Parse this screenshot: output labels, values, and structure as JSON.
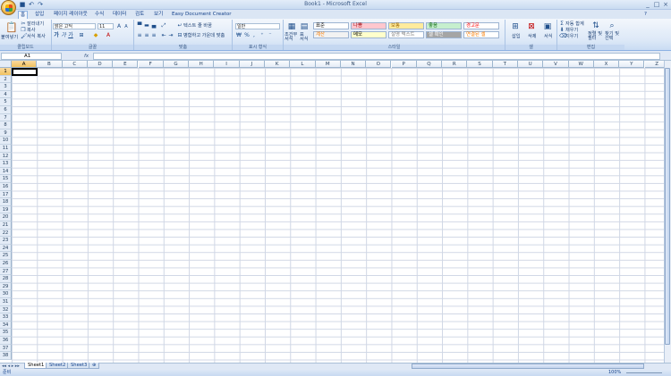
{
  "window": {
    "title": "Book1 - Microsoft Excel",
    "controls": [
      "_",
      "□",
      "×"
    ]
  },
  "qat": {
    "save_icon": "save-icon",
    "undo_icon": "undo-icon",
    "redo_icon": "redo-icon"
  },
  "tabs": [
    {
      "label": "홈",
      "active": true
    },
    {
      "label": "삽입"
    },
    {
      "label": "페이지 레이아웃"
    },
    {
      "label": "수식"
    },
    {
      "label": "데이터"
    },
    {
      "label": "검토"
    },
    {
      "label": "보기"
    },
    {
      "label": "Easy Document Creator"
    }
  ],
  "ribbon": {
    "clipboard": {
      "paste_label": "붙여넣기",
      "cut_label": "잘라내기",
      "copy_label": "복사",
      "format_painter_label": "서식 복사",
      "group_label": "클립보드"
    },
    "font": {
      "font_name": "맑은 고딕",
      "font_size": "11",
      "group_label": "글꼴"
    },
    "alignment": {
      "wrap_text_label": "텍스트 줄 바꿈",
      "merge_center_label": "병합하고 가운데 맞춤",
      "group_label": "맞춤"
    },
    "number": {
      "format": "일반",
      "group_label": "표시 형식"
    },
    "styles": {
      "conditional_label": "조건부\n서식",
      "table_label": "표\n서식",
      "group_label": "스타일",
      "cells": [
        {
          "label": "표준",
          "bg": "#ffffff",
          "color": "#000000"
        },
        {
          "label": "나쁨",
          "bg": "#ffc7ce",
          "color": "#9c0006"
        },
        {
          "label": "보통",
          "bg": "#ffeb9c",
          "color": "#9c6500"
        },
        {
          "label": "좋음",
          "bg": "#c6efce",
          "color": "#006100"
        },
        {
          "label": "경고문",
          "bg": "#ffffff",
          "color": "#ff0000"
        },
        {
          "label": "계산",
          "bg": "#f2f2f2",
          "color": "#fa7d00"
        },
        {
          "label": "메모",
          "bg": "#ffffcc",
          "color": "#000000"
        },
        {
          "label": "설명 텍스트",
          "bg": "#ffffff",
          "color": "#7f7f7f"
        },
        {
          "label": "셀 확인",
          "bg": "#a5a5a5",
          "color": "#ffffff"
        },
        {
          "label": "연결된 셀",
          "bg": "#ffffff",
          "color": "#fa7d00"
        }
      ]
    },
    "cells_group": {
      "insert_label": "삽입",
      "delete_label": "삭제",
      "format_label": "서식",
      "group_label": "셀"
    },
    "editing": {
      "autosum_label": "자동 합계",
      "fill_label": "채우기",
      "clear_label": "지우기",
      "sort_label": "정렬 및\n필터",
      "find_label": "찾기 및\n선택",
      "group_label": "편집"
    }
  },
  "formula_bar": {
    "name_box": "A1",
    "fx": "fx",
    "value": ""
  },
  "columns": [
    "A",
    "B",
    "C",
    "D",
    "E",
    "F",
    "G",
    "H",
    "I",
    "J",
    "K",
    "L",
    "M",
    "N",
    "O",
    "P",
    "Q",
    "R",
    "S",
    "T",
    "U",
    "V",
    "W",
    "X",
    "Y",
    "Z"
  ],
  "rows": [
    "1",
    "2",
    "3",
    "4",
    "5",
    "6",
    "7",
    "8",
    "9",
    "10",
    "11",
    "12",
    "13",
    "14",
    "15",
    "16",
    "17",
    "18",
    "19",
    "20",
    "21",
    "22",
    "23",
    "24",
    "25",
    "26",
    "27",
    "28",
    "29",
    "30",
    "31",
    "32",
    "33",
    "34",
    "35",
    "36",
    "37",
    "38"
  ],
  "selected_cell": {
    "column": "A",
    "row": "1"
  },
  "sheets": [
    {
      "label": "Sheet1",
      "active": true
    },
    {
      "label": "Sheet2"
    },
    {
      "label": "Sheet3"
    }
  ],
  "status": {
    "ready": "준비",
    "zoom": "100%"
  },
  "colors": {
    "accent": "#15428b",
    "selection": "#f1c15f"
  }
}
